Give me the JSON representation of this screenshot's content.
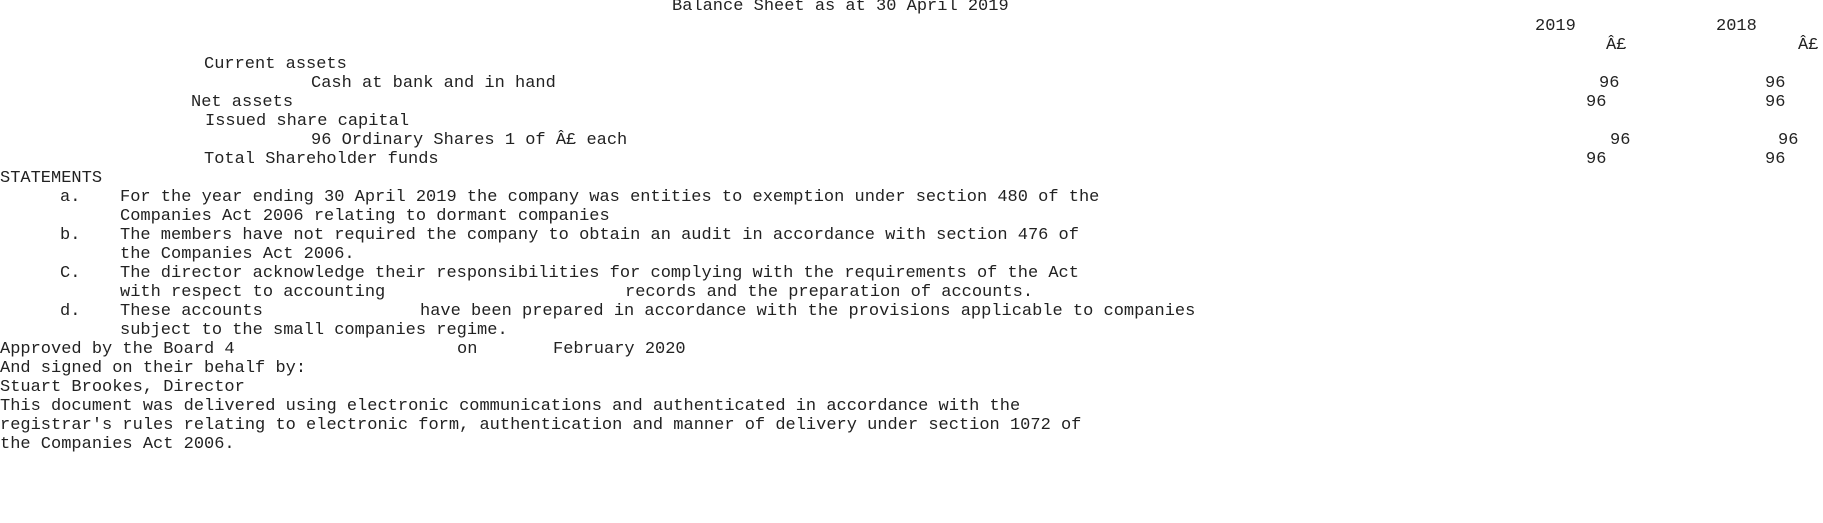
{
  "title": "Balance Sheet as at 30 April 2019",
  "columns": {
    "year_current": "2019",
    "year_prior": "2018",
    "currency_current": "Â£",
    "currency_prior": "Â£"
  },
  "balance_sheet": {
    "current_assets_label": "Current assets",
    "cash_label": "Cash at bank and in hand",
    "cash_current": "96",
    "cash_prior": "96",
    "net_assets_label": "Net assets",
    "net_assets_current": "96",
    "net_assets_prior": "96",
    "share_capital_label": "Issued share capital",
    "shares_label": "96 Ordinary Shares 1 of Â£ each",
    "shares_current": "96",
    "shares_prior": "96",
    "shareholder_funds_label": "Total Shareholder funds",
    "shareholder_funds_current": "96",
    "shareholder_funds_prior": "96"
  },
  "statements": {
    "heading": "STATEMENTS",
    "items": [
      {
        "marker": "a.",
        "line1": "For the year ending 30 April 2019 the company was entities to exemption under section 480 of the",
        "line2": "Companies Act 2006 relating to dormant companies"
      },
      {
        "marker": "b.",
        "line1": "The members have not required the company to obtain an audit in accordance with section 476 of",
        "line2": "the Companies Act 2006."
      },
      {
        "marker": "C.",
        "line1": "The director acknowledge their responsibilities for complying with the requirements of the Act",
        "line2a": "with respect to accounting",
        "line2b": "records and the preparation of accounts."
      },
      {
        "marker": "d.",
        "line1a": "These accounts",
        "line1b": "have been prepared in accordance with the provisions applicable to companies",
        "line2": "subject to the small companies regime."
      }
    ]
  },
  "approval": {
    "approved_by": "Approved by the Board 4",
    "on": "on",
    "date": "February 2020",
    "signed": "And signed on their behalf by:",
    "director": "Stuart Brookes, Director"
  },
  "footer": {
    "line1": "This document was delivered using electronic communications and authenticated in accordance with the",
    "line2": "registrar's rules relating to electronic form, authentication and manner of delivery under section 1072 of",
    "line3": "the Companies Act 2006."
  }
}
